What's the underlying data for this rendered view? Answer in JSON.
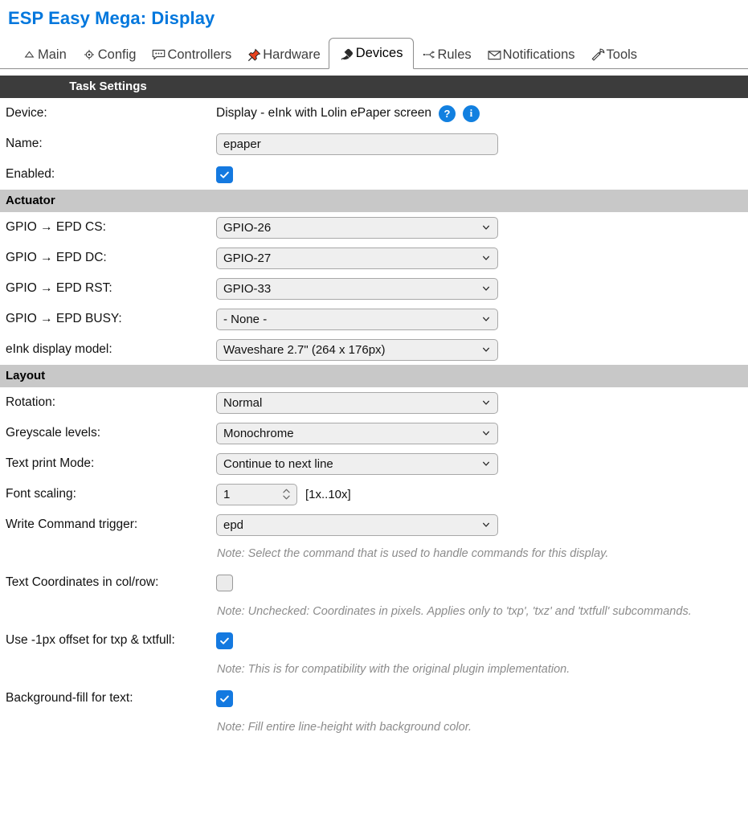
{
  "header": {
    "title": "ESP Easy Mega: Display"
  },
  "tabs": [
    {
      "label": "Main",
      "icon": "home-icon",
      "active": false
    },
    {
      "label": "Config",
      "icon": "gear-icon",
      "active": false
    },
    {
      "label": "Controllers",
      "icon": "chat-icon",
      "active": false
    },
    {
      "label": "Hardware",
      "icon": "pin-icon",
      "active": false
    },
    {
      "label": "Devices",
      "icon": "plug-icon",
      "active": true
    },
    {
      "label": "Rules",
      "icon": "branch-icon",
      "active": false
    },
    {
      "label": "Notifications",
      "icon": "envelope-icon",
      "active": false
    },
    {
      "label": "Tools",
      "icon": "wrench-icon",
      "active": false
    }
  ],
  "task_settings": {
    "title": "Task Settings",
    "device_label": "Device:",
    "device_value": "Display - eInk with Lolin ePaper screen",
    "help_badge": "?",
    "info_badge": "i",
    "name_label": "Name:",
    "name_value": "epaper",
    "enabled_label": "Enabled:",
    "enabled_checked": true
  },
  "actuator": {
    "title": "Actuator",
    "rows": [
      {
        "label": "GPIO → EPD CS:",
        "value": "GPIO-26"
      },
      {
        "label": "GPIO → EPD DC:",
        "value": "GPIO-27"
      },
      {
        "label": "GPIO → EPD RST:",
        "value": "GPIO-33"
      },
      {
        "label": "GPIO → EPD BUSY:",
        "value": "- None -"
      },
      {
        "label": "eInk display model:",
        "value": "Waveshare 2.7\" (264 x 176px)"
      }
    ]
  },
  "layout": {
    "title": "Layout",
    "rotation_label": "Rotation:",
    "rotation_value": "Normal",
    "greyscale_label": "Greyscale levels:",
    "greyscale_value": "Monochrome",
    "textmode_label": "Text print Mode:",
    "textmode_value": "Continue to next line",
    "fontscale_label": "Font scaling:",
    "fontscale_value": "1",
    "fontscale_hint": "[1x..10x]",
    "writecmd_label": "Write Command trigger:",
    "writecmd_value": "epd",
    "writecmd_note": "Note: Select the command that is used to handle commands for this display.",
    "coords_label": "Text Coordinates in col/row:",
    "coords_checked": false,
    "coords_note": "Note: Unchecked: Coordinates in pixels. Applies only to 'txp', 'txz' and 'txtfull' subcommands.",
    "offset_label": "Use -1px offset for txp & txtfull:",
    "offset_checked": true,
    "offset_note": "Note: This is for compatibility with the original plugin implementation.",
    "bgfill_label": "Background-fill for text:",
    "bgfill_checked": true,
    "bgfill_note": "Note: Fill entire line-height with background color."
  },
  "colors": {
    "accent": "#0077dd",
    "badge": "#1280e0",
    "checkbox": "#1479e0",
    "section_dark": "#3c3c3c",
    "section_grey": "#c8c8c8",
    "note": "#8c8c8c"
  }
}
